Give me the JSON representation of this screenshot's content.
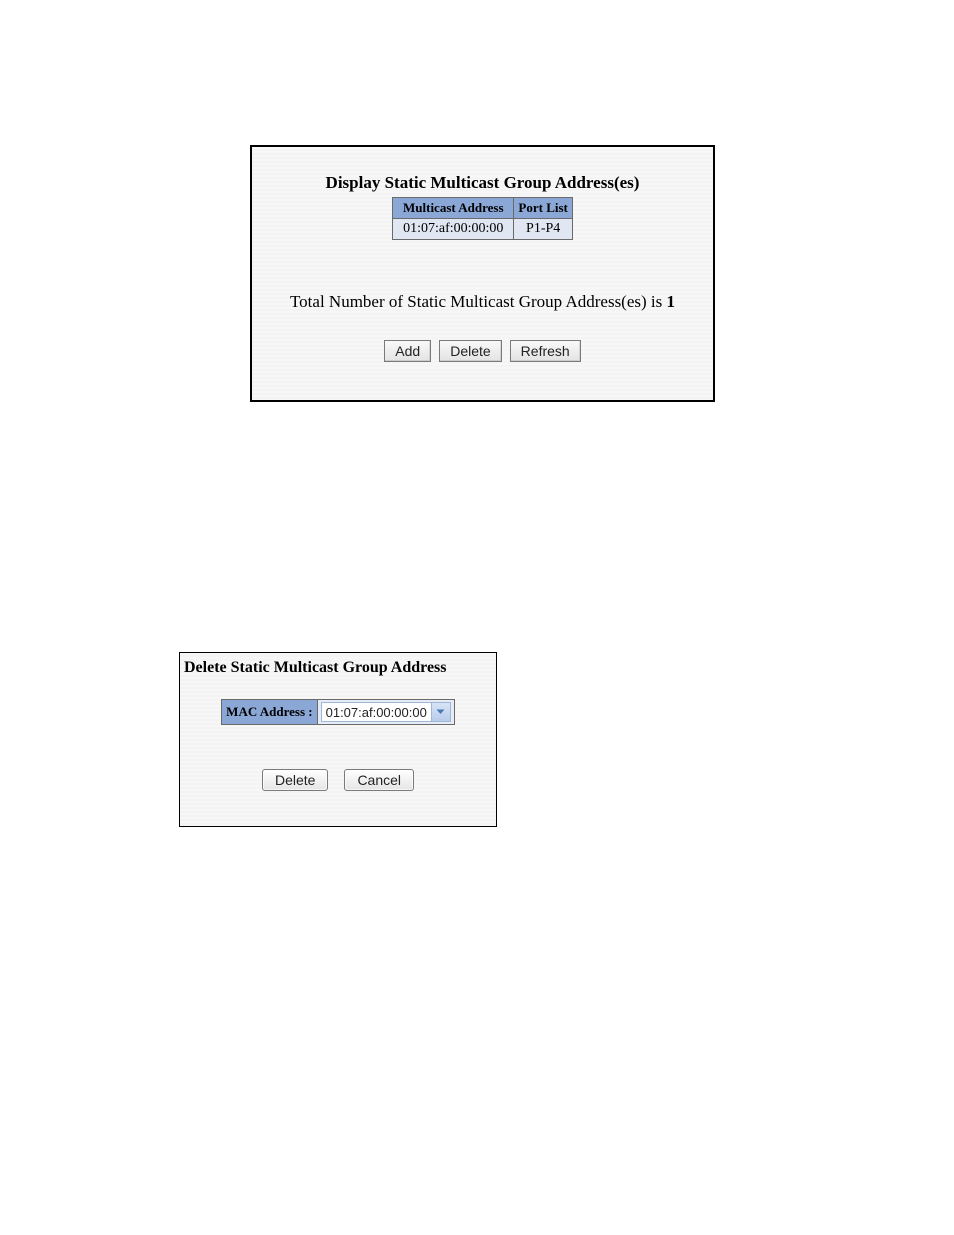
{
  "display_panel": {
    "title": "Display Static Multicast Group Address(es)",
    "headers": {
      "address": "Multicast Address",
      "portlist": "Port List"
    },
    "rows": [
      {
        "address": "01:07:af:00:00:00",
        "portlist": "P1-P4"
      }
    ],
    "total_prefix": "Total Number of Static Multicast Group Address(es) is ",
    "total_count": "1",
    "buttons": {
      "add": "Add",
      "delete": "Delete",
      "refresh": "Refresh"
    }
  },
  "delete_panel": {
    "title": "Delete Static Multicast Group Address",
    "label": "MAC Address :",
    "selected": "01:07:af:00:00:00",
    "buttons": {
      "delete": "Delete",
      "cancel": "Cancel"
    }
  }
}
